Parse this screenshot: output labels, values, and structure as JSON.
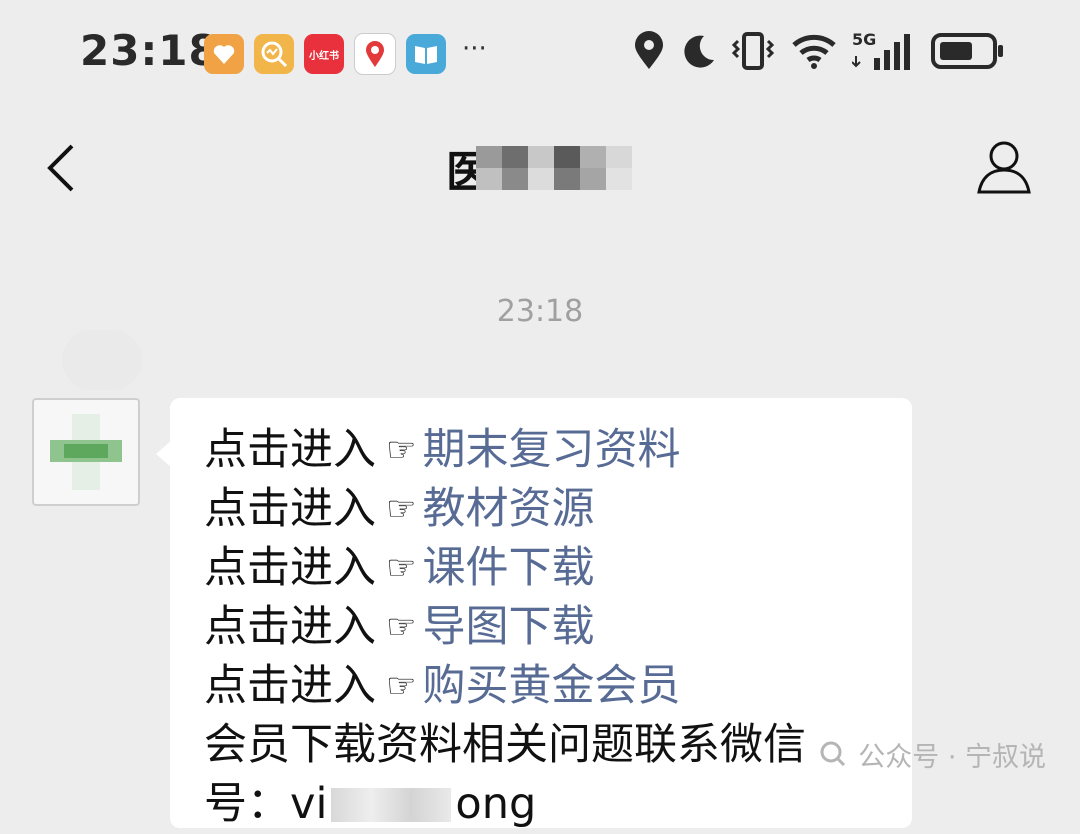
{
  "status_bar": {
    "time": "23:18",
    "app_icons": [
      "health-icon",
      "find-icon",
      "xiaohongshu-icon",
      "map-icon",
      "book-icon"
    ],
    "xhs_label": "小红书",
    "more": "···",
    "system_icons": [
      "location-icon",
      "moon-icon",
      "vibrate-icon",
      "wifi-icon",
      "signal-5g-icon",
      "battery-icon"
    ],
    "network": "5G"
  },
  "header": {
    "title_visible": "医",
    "back_icon": "chevron-left-icon",
    "profile_icon": "person-icon"
  },
  "chat": {
    "timestamp": "23:18",
    "messages": [
      {
        "prefix": "点击进入",
        "hand": "☞",
        "link": "期末复习资料"
      },
      {
        "prefix": "点击进入",
        "hand": "☞",
        "link": "教材资源"
      },
      {
        "prefix": "点击进入",
        "hand": "☞",
        "link": "课件下载"
      },
      {
        "prefix": "点击进入",
        "hand": "☞",
        "link": "导图下载"
      },
      {
        "prefix": "点击进入",
        "hand": "☞",
        "link": "购买黄金会员"
      }
    ],
    "contact_line": "会员下载资料相关问题联系微信",
    "contact_line2_start": "号：vi",
    "contact_line2_end": "ong"
  },
  "watermark": {
    "text": "公众号 · 宁叔说"
  },
  "colors": {
    "background": "#ededed",
    "bubble": "#ffffff",
    "link": "#576b95",
    "timestamp": "#a0a0a0"
  }
}
